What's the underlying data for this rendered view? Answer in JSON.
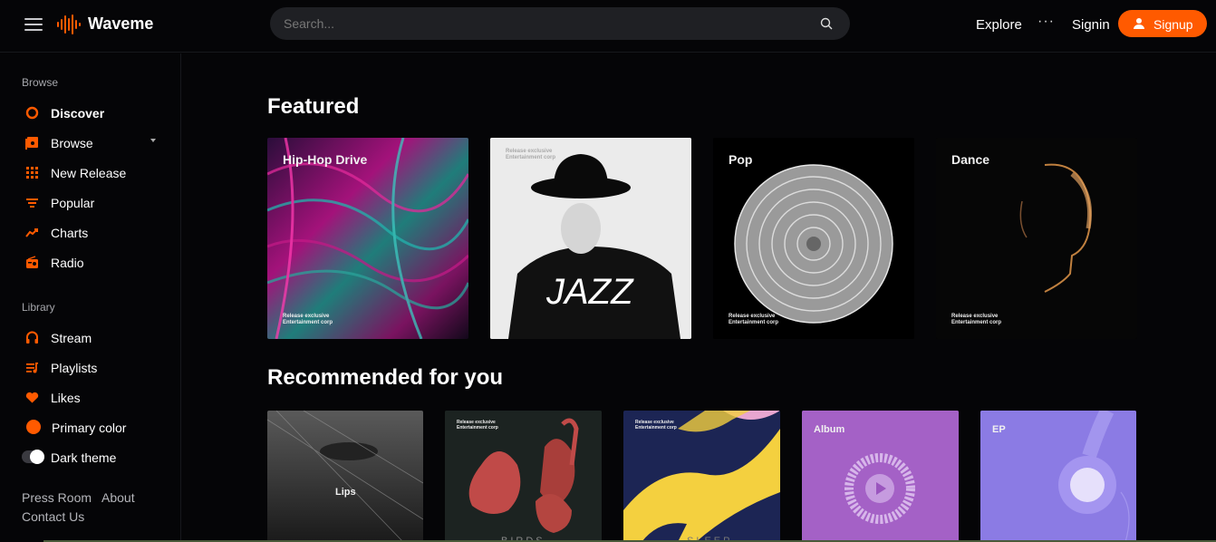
{
  "app": {
    "name": "Waveme"
  },
  "search": {
    "placeholder": "Search..."
  },
  "header": {
    "explore": "Explore",
    "more": "···",
    "signin": "Signin",
    "signup": "Signup"
  },
  "colors": {
    "accent": "#ff5a00",
    "background": "#050507",
    "panel": "#1f2024"
  },
  "sidebar": {
    "browse_title": "Browse",
    "browse_items": [
      {
        "label": "Discover",
        "icon": "discover-icon"
      },
      {
        "label": "Browse",
        "icon": "browse-icon"
      },
      {
        "label": "New Release",
        "icon": "grid-icon"
      },
      {
        "label": "Popular",
        "icon": "popular-icon"
      },
      {
        "label": "Charts",
        "icon": "trend-icon"
      },
      {
        "label": "Radio",
        "icon": "radio-icon"
      }
    ],
    "library_title": "Library",
    "library_items": [
      {
        "label": "Stream",
        "icon": "headphones-icon"
      },
      {
        "label": "Playlists",
        "icon": "playlist-icon"
      },
      {
        "label": "Likes",
        "icon": "heart-icon"
      },
      {
        "label": "Primary color",
        "icon": "color-dot-icon"
      },
      {
        "label": "Dark theme",
        "icon": "toggle-icon"
      }
    ],
    "footer": {
      "press": "Press Room",
      "about": "About",
      "contact": "Contact Us"
    }
  },
  "featured": {
    "title": "Featured",
    "cards": [
      {
        "title": "Hip-Hop Drive",
        "caption": "Release exclusive\nEntertainment corp"
      },
      {
        "title": "JAZZ",
        "caption": "Release exclusive\nEntertainment corp"
      },
      {
        "title": "Pop",
        "caption": "Release exclusive\nEntertainment corp"
      },
      {
        "title": "Dance",
        "caption": "Release exclusive\nEntertainment corp"
      }
    ]
  },
  "recommended": {
    "title": "Recommended for you",
    "cards": [
      {
        "title": "Lips",
        "caption": ""
      },
      {
        "title": "BIRDS",
        "caption": "Release exclusive\nEntertainment corp"
      },
      {
        "title": "SLEEP",
        "caption": "Release exclusive\nEntertainment corp"
      },
      {
        "title": "Album",
        "caption": ""
      },
      {
        "title": "EP",
        "caption": ""
      }
    ]
  }
}
